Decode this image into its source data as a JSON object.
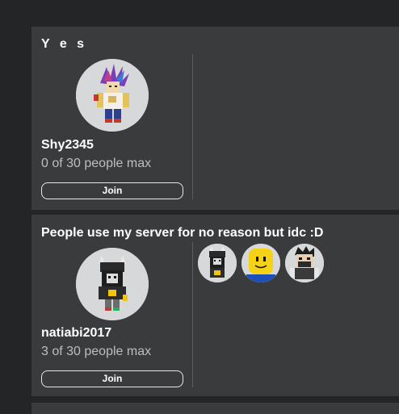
{
  "servers": [
    {
      "name": "Y e s",
      "owner": "Shy2345",
      "capacity": "0 of 30 people max",
      "join_label": "Join",
      "players": []
    },
    {
      "name": "People use my server for no reason but idc :D",
      "owner": "natiabi2017",
      "capacity": "3 of 30 people max",
      "join_label": "Join",
      "players": [
        {
          "icon": "player-avatar-1"
        },
        {
          "icon": "player-avatar-2"
        },
        {
          "icon": "player-avatar-3"
        }
      ]
    }
  ],
  "colors": {
    "background": "#232527",
    "card": "#393b3d",
    "text": "#ffffff",
    "muted_text": "#bdbebe",
    "avatar_bg": "#d7d8d9"
  }
}
